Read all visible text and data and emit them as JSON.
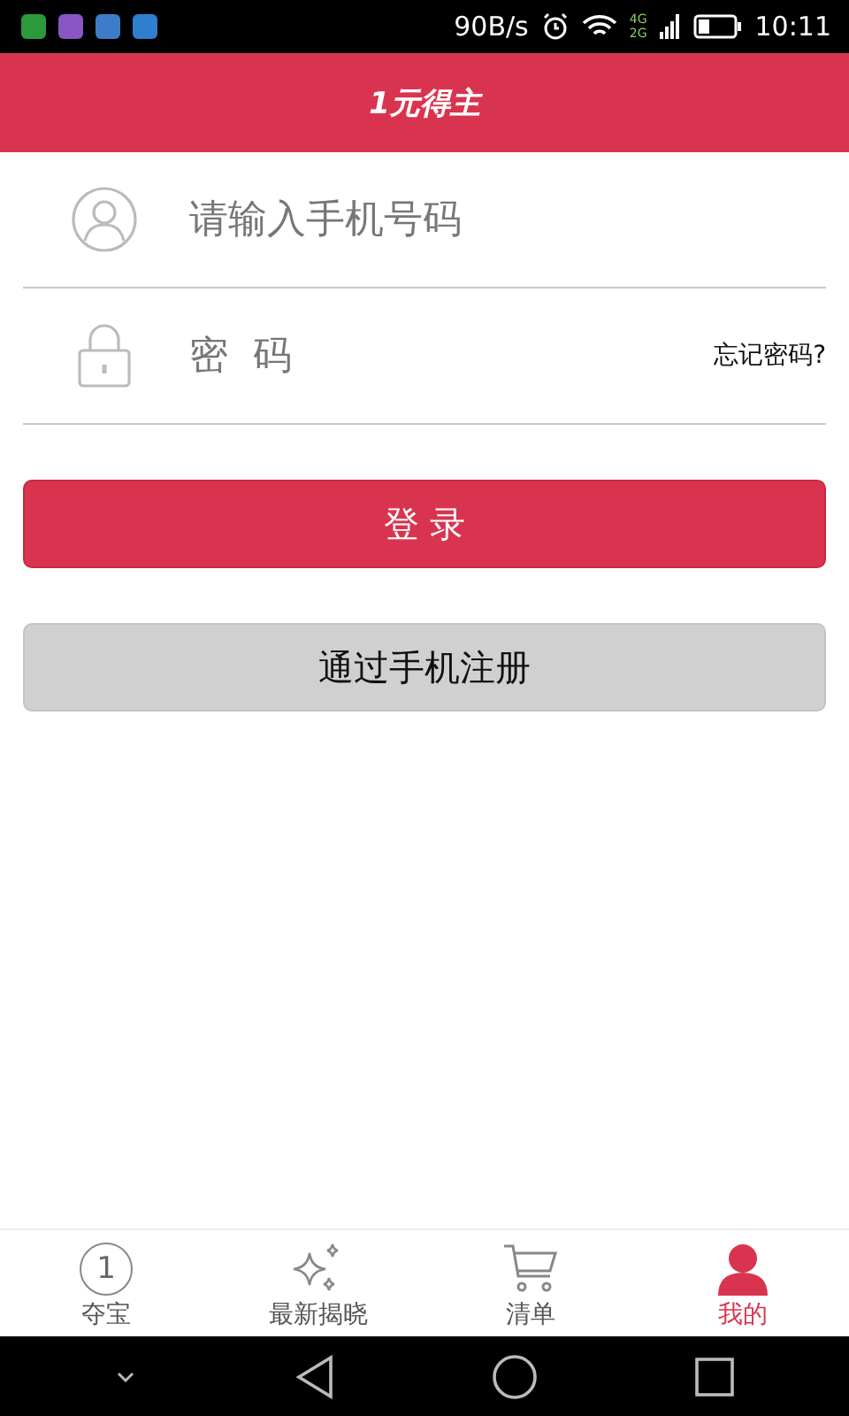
{
  "status_bar": {
    "speed": "90B/s",
    "net_top": "4G",
    "net_bottom": "2G",
    "time": "10:11"
  },
  "header": {
    "title": "1元得主"
  },
  "phone_field": {
    "placeholder": "请输入手机号码"
  },
  "password_field": {
    "placeholder": "密  码",
    "forgot_link": "忘记密码?"
  },
  "login_button": "登 录",
  "register_button": "通过手机注册",
  "tabs": [
    {
      "label": "夺宝",
      "kind": "coin",
      "badge": "1",
      "selected": false
    },
    {
      "label": "最新揭晓",
      "kind": "sparkle",
      "selected": false
    },
    {
      "label": "清单",
      "kind": "cart",
      "selected": false
    },
    {
      "label": "我的",
      "kind": "person",
      "selected": true
    }
  ]
}
